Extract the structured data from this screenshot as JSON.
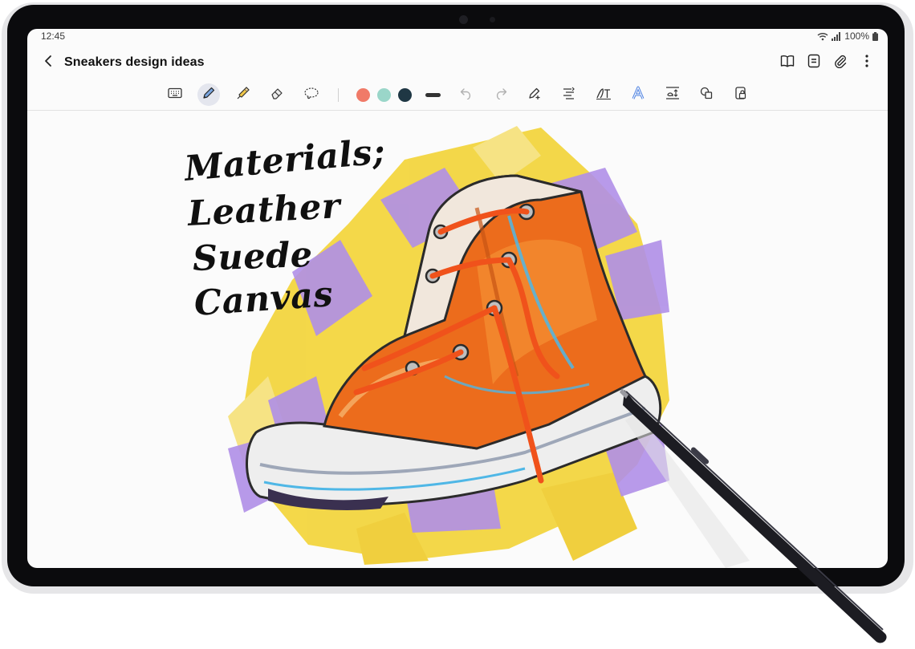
{
  "status_bar": {
    "time": "12:45",
    "battery": "100%"
  },
  "header": {
    "title": "Sneakers design ideas"
  },
  "toolbar": {
    "tools": [
      "keyboard-icon",
      "pen-icon",
      "highlighter-icon",
      "eraser-icon",
      "lasso-icon"
    ],
    "active_tool": "pen-icon",
    "pen_colors": [
      "#f07a68",
      "#9ad6c9",
      "#1f3744"
    ],
    "actions": [
      "undo-icon",
      "redo-icon",
      "pen-settings-icon",
      "straighten-icon",
      "text-style-icon",
      "text-effect-icon",
      "text-box-icon",
      "shapes-icon",
      "lock-icon"
    ]
  },
  "note": {
    "handwriting": [
      "Materials;",
      "Leather",
      "Suede",
      "Canvas"
    ]
  },
  "colors": {
    "sneaker_orange": "#ec6c1c",
    "splash_yellow": "#f3d53a",
    "splash_purple": "#b08fe8",
    "sole_white": "#eeeeee",
    "accent_blue": "#4fb7e6"
  }
}
